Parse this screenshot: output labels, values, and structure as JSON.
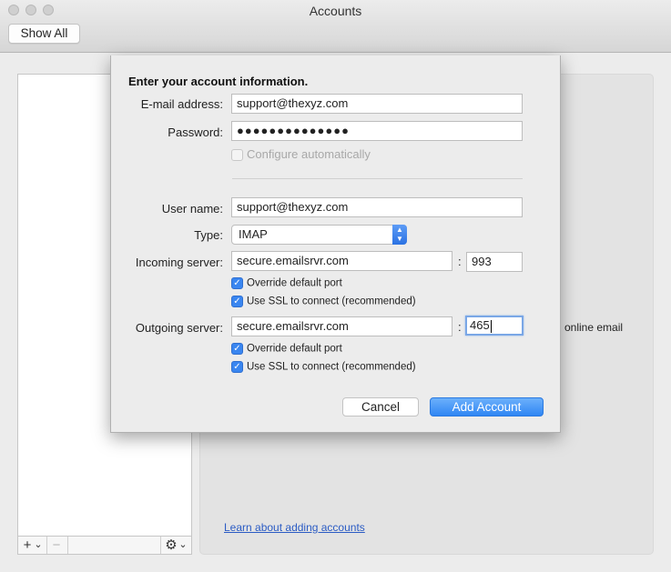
{
  "window": {
    "title": "Accounts"
  },
  "toolbar": {
    "show_all": "Show All"
  },
  "list_toolbar": {
    "add": "+",
    "add_arrow": "⌄",
    "remove": "−",
    "gear": "⚙",
    "gear_arrow": "⌄"
  },
  "background": {
    "online_email_fragment": "online email",
    "learn_link": "Learn about adding accounts"
  },
  "sheet": {
    "heading": "Enter your account information.",
    "email_label": "E-mail address:",
    "email_value": "support@thexyz.com",
    "password_label": "Password:",
    "password_value": "●●●●●●●●●●●●●●",
    "configure_auto": "Configure automatically",
    "configure_auto_checked": false,
    "username_label": "User name:",
    "username_value": "support@thexyz.com",
    "type_label": "Type:",
    "type_value": "IMAP",
    "incoming_label": "Incoming server:",
    "incoming_value": "secure.emailsrvr.com",
    "incoming_port": "993",
    "incoming_override": "Override default port",
    "incoming_ssl": "Use SSL to connect (recommended)",
    "outgoing_label": "Outgoing server:",
    "outgoing_value": "secure.emailsrvr.com",
    "outgoing_port": "465",
    "outgoing_override": "Override default port",
    "outgoing_ssl": "Use SSL to connect (recommended)",
    "colon": ":",
    "cancel": "Cancel",
    "add_account": "Add Account"
  },
  "colors": {
    "accent": "#2f86f4",
    "link": "#2a5bc4"
  }
}
